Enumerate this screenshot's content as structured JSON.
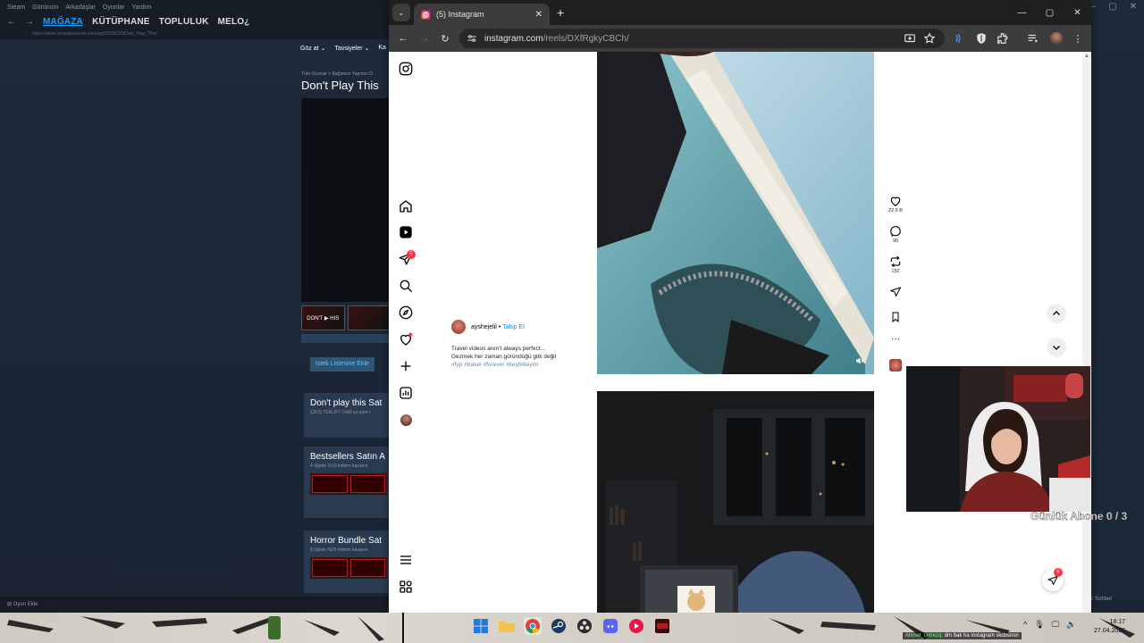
{
  "steam": {
    "menubar": [
      "Steam",
      "Görünüm",
      "Arkadaşlar",
      "Oyunlar",
      "Yardım"
    ],
    "tabs": [
      {
        "label": "MAĞAZA",
        "active": true
      },
      {
        "label": "KÜTÜPHANE",
        "active": false
      },
      {
        "label": "TOPLULUK",
        "active": false
      },
      {
        "label": "MELO¿",
        "active": false
      }
    ],
    "url": "https://store.steampowered.com/app/3319120/Dont_Play_This/",
    "storebar": [
      "Göz at ⌄",
      "Tavsiyeler ⌄",
      "Ka"
    ],
    "breadcrumb": "Tüm Oyunlar > Bağımsız Yapımcı O",
    "game_title": "Don't Play This",
    "thumb_label": "DON'T ▶ HIS",
    "wishlist_button": "İstek Listesine Ekle",
    "cards": [
      {
        "title": "Don't play this Sat",
        "sub": "ÇIKIŞ TEKLİFİ! Teklif şu süre i"
      },
      {
        "title": "Bestsellers Satın A",
        "sub": "4 öğede %10 indirim kazanın"
      },
      {
        "title": "Horror Bundle Sat",
        "sub": "8 öğede %25 indirim kazanın"
      }
    ],
    "footer_add_game": "Oyun Ekle",
    "friends_chat": "ar ve Sohbet"
  },
  "chrome": {
    "tab_title": "(5) Instagram",
    "url_host": "instagram.com",
    "url_path": "/reels/DXfRgkyCBCh/"
  },
  "instagram": {
    "nav_badge_messages": "5",
    "caption": {
      "username": "ayshejelil",
      "separator": " • ",
      "follow": "Takip Et",
      "line1": "Travel videos aren't always perfect…",
      "line2": "Gezmek her zaman göründüğü gibi değil",
      "tags": "#fyp #travel #forever #keşfetteyim"
    },
    "actions": {
      "likes": "22,6 B",
      "comments": "90",
      "reposts": "152"
    },
    "message_fab_badge": "6"
  },
  "stream_overlay": {
    "goal_text": "Günlük Abone 0 / 3",
    "chat_nick": "Ahmet_cetrezq",
    "chat_message": ": dm bak ha instagram skdbsnsn"
  },
  "taskbar": {
    "time": "18:17",
    "date": "27.04.2026"
  },
  "colors": {
    "instagram_blue": "#0095f6",
    "badge_red": "#ff3040",
    "steam_blue": "#1a9fff",
    "chrome_dark": "#3c3c3c"
  }
}
